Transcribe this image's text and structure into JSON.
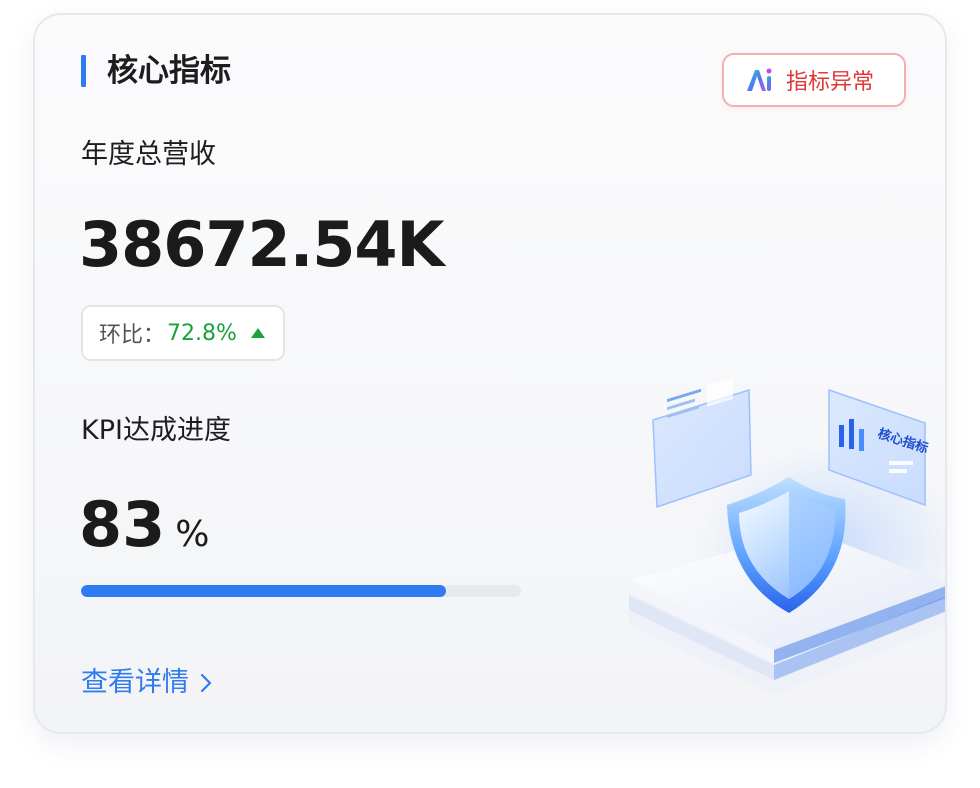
{
  "card": {
    "title": "核心指标",
    "anomaly_button": {
      "label": "指标异常",
      "icon": "ai-logo-icon"
    },
    "revenue": {
      "label": "年度总营收",
      "value": "38672.54K",
      "mom_label": "环比：",
      "mom_value": "72.8%",
      "mom_trend": "up"
    },
    "kpi": {
      "label": "KPI达成进度",
      "value": "83",
      "unit": "%",
      "progress": 0.83
    },
    "detail_link": "查看详情",
    "illustration": {
      "panel_text": "核心指标"
    },
    "colors": {
      "accent": "#2f7bf0",
      "danger": "#e0373a",
      "positive": "#19a33a"
    }
  }
}
